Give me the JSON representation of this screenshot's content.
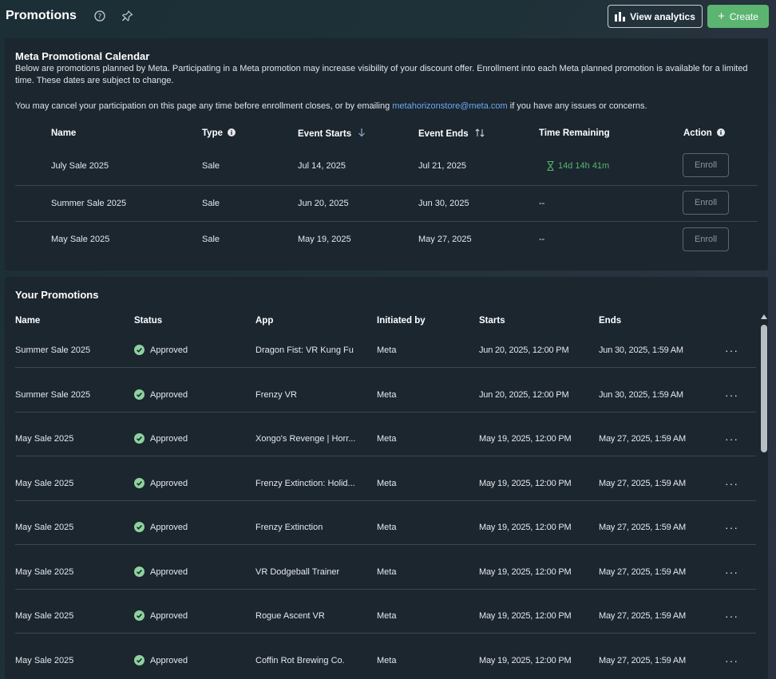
{
  "header": {
    "title": "Promotions",
    "analytics_label": "View analytics",
    "create_label": "Create"
  },
  "calendar": {
    "title": "Meta Promotional Calendar",
    "description": "Below are promotions planned by Meta. Participating in a Meta promotion may increase visibility of your discount offer. Enrollment into each Meta planned promotion is available for a limited time. These dates are subject to change.",
    "cancel_prefix": "You may cancel your participation on this page any time before enrollment closes, or by emailing ",
    "cancel_email": "metahorizonstore@meta.com",
    "cancel_suffix": " if you have any issues or concerns.",
    "columns": {
      "name": "Name",
      "type": "Type",
      "starts": "Event Starts",
      "ends": "Event Ends",
      "remaining": "Time Remaining",
      "action": "Action"
    },
    "rows": [
      {
        "name": "July Sale 2025",
        "type": "Sale",
        "starts": "Jul 14, 2025",
        "ends": "Jul 21, 2025",
        "remaining": "14d 14h 41m",
        "action": "Enroll"
      },
      {
        "name": "Summer Sale 2025",
        "type": "Sale",
        "starts": "Jun 20, 2025",
        "ends": "Jun 30, 2025",
        "remaining": "--",
        "action": "Enroll"
      },
      {
        "name": "May Sale 2025",
        "type": "Sale",
        "starts": "May 19, 2025",
        "ends": "May 27, 2025",
        "remaining": "--",
        "action": "Enroll"
      }
    ]
  },
  "yours": {
    "title": "Your Promotions",
    "columns": {
      "name": "Name",
      "status": "Status",
      "app": "App",
      "initiated": "Initiated by",
      "starts": "Starts",
      "ends": "Ends"
    },
    "rows": [
      {
        "name": "Summer Sale 2025",
        "status": "Approved",
        "app": "Dragon Fist: VR Kung Fu",
        "initiated": "Meta",
        "starts": "Jun 20, 2025, 12:00 PM",
        "ends": "Jun 30, 2025, 1:59 AM"
      },
      {
        "name": "Summer Sale 2025",
        "status": "Approved",
        "app": "Frenzy VR",
        "initiated": "Meta",
        "starts": "Jun 20, 2025, 12:00 PM",
        "ends": "Jun 30, 2025, 1:59 AM"
      },
      {
        "name": "May Sale 2025",
        "status": "Approved",
        "app": "Xongo's Revenge | Horr...",
        "initiated": "Meta",
        "starts": "May 19, 2025, 12:00 PM",
        "ends": "May 27, 2025, 1:59 AM"
      },
      {
        "name": "May Sale 2025",
        "status": "Approved",
        "app": "Frenzy Extinction: Holid...",
        "initiated": "Meta",
        "starts": "May 19, 2025, 12:00 PM",
        "ends": "May 27, 2025, 1:59 AM"
      },
      {
        "name": "May Sale 2025",
        "status": "Approved",
        "app": "Frenzy Extinction",
        "initiated": "Meta",
        "starts": "May 19, 2025, 12:00 PM",
        "ends": "May 27, 2025, 1:59 AM"
      },
      {
        "name": "May Sale 2025",
        "status": "Approved",
        "app": "VR Dodgeball Trainer",
        "initiated": "Meta",
        "starts": "May 19, 2025, 12:00 PM",
        "ends": "May 27, 2025, 1:59 AM"
      },
      {
        "name": "May Sale 2025",
        "status": "Approved",
        "app": "Rogue Ascent VR",
        "initiated": "Meta",
        "starts": "May 19, 2025, 12:00 PM",
        "ends": "May 27, 2025, 1:59 AM"
      },
      {
        "name": "May Sale 2025",
        "status": "Approved",
        "app": "Coffin Rot Brewing Co.",
        "initiated": "Meta",
        "starts": "May 19, 2025, 12:00 PM",
        "ends": "May 27, 2025, 1:59 AM"
      }
    ],
    "more_label": "···"
  },
  "colors": {
    "accent_green": "#5bb571",
    "link_blue": "#6ea8f0",
    "panel_bg": "#1b262f"
  }
}
